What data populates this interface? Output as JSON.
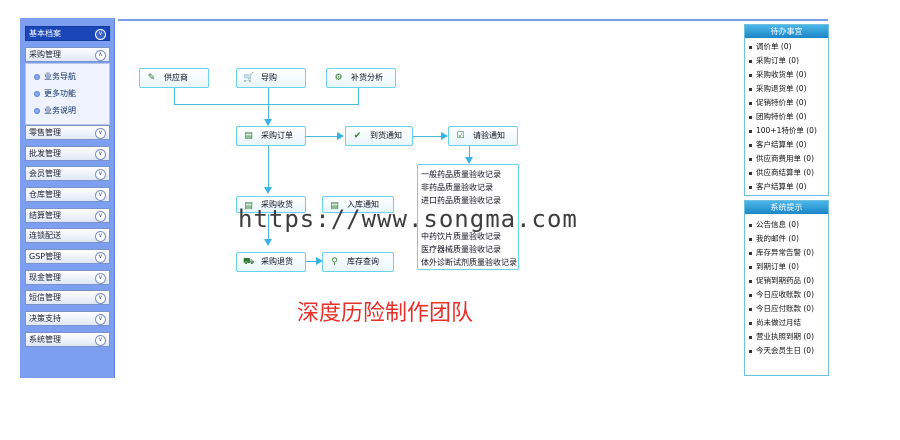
{
  "sidebar": {
    "groups": [
      "基本档案",
      "采购管理",
      "零售管理",
      "批发管理",
      "会员管理",
      "仓库管理",
      "结算管理",
      "连锁配送",
      "GSP管理",
      "现金管理",
      "短信管理",
      "决策支持",
      "系统管理"
    ],
    "purchase_sub": [
      "业务导航",
      "更多功能",
      "业务说明"
    ]
  },
  "flow": {
    "supplier": "供应商",
    "import": "导购",
    "restock_analysis": "补货分析",
    "purchase_order": "采购订单",
    "arrival_notice": "到货通知",
    "inspection_notice": "请验通知",
    "purchase_receiving": "采购收货",
    "storage_notice": "入库通知",
    "purchase_return": "采购退货",
    "inventory_query": "库存查询",
    "inspection_records": [
      "一般药品质量验收记录",
      "非药品质量验收记录",
      "进口药品质量验收记录",
      "",
      "中药饮片质量验收记录",
      "医疗器械质量验收记录",
      "体外诊断试剂质量验收记录"
    ]
  },
  "watermark": "https://www.songma.com",
  "team_label": "深度历险制作团队",
  "todo_panel": {
    "title": "待办事宜",
    "items": [
      "调价单 (0)",
      "采购订单 (0)",
      "采购收货单 (0)",
      "采购退货单 (0)",
      "促销特价单 (0)",
      "团购特价单 (0)",
      "100+1特价单 (0)",
      "客户结算单 (0)",
      "供应商费用单 (0)",
      "供应商结算单 (0)",
      "客户结算单 (0)"
    ]
  },
  "notice_panel": {
    "title": "系统提示",
    "items": [
      "公告信息 (0)",
      "我的邮件 (0)",
      "库存异常告警 (0)",
      "到期订单 (0)",
      "促销到期药品 (0)",
      "今日应收账款 (0)",
      "今日应付账款 (0)",
      "尚未做过月结",
      "营业执照到期 (0)",
      "今天会员生日 (0)"
    ]
  }
}
